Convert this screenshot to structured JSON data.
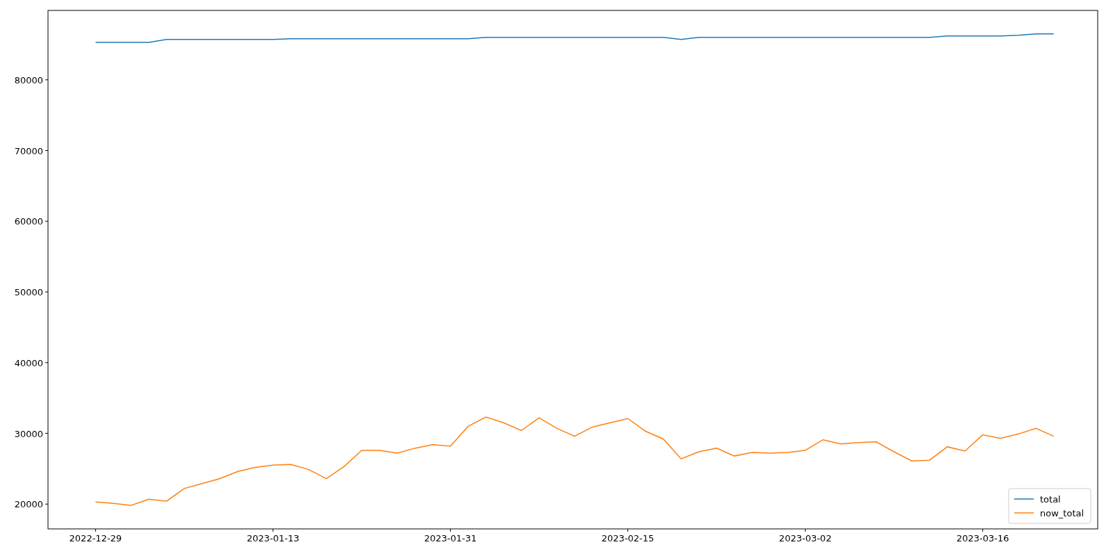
{
  "figure": {
    "chart_data": {
      "type": "line",
      "categories": [
        "2022-12-29",
        null,
        null,
        null,
        null,
        null,
        null,
        null,
        null,
        null,
        "2023-01-13",
        null,
        null,
        null,
        null,
        null,
        null,
        null,
        null,
        null,
        "2023-01-31",
        null,
        null,
        null,
        null,
        null,
        null,
        null,
        null,
        null,
        "2023-02-15",
        null,
        null,
        null,
        null,
        null,
        null,
        null,
        null,
        null,
        "2023-03-02",
        null,
        null,
        null,
        null,
        null,
        null,
        null,
        null,
        null,
        "2023-03-16",
        null,
        null,
        null,
        null
      ],
      "ylim": [
        16490,
        89810
      ],
      "legend": "lower right",
      "yticks": [
        20000,
        30000,
        40000,
        50000,
        60000,
        70000,
        80000
      ],
      "series": [
        {
          "name": "total",
          "color": "#1f77b4",
          "values": [
            85300,
            85300,
            85300,
            85300,
            85700,
            85700,
            85700,
            85700,
            85700,
            85700,
            85700,
            85800,
            85800,
            85800,
            85800,
            85800,
            85800,
            85800,
            85800,
            85800,
            85800,
            85800,
            86000,
            86000,
            86000,
            86000,
            86000,
            86000,
            86000,
            86000,
            86000,
            86000,
            86000,
            85700,
            86000,
            86000,
            86000,
            86000,
            86000,
            86000,
            86000,
            86000,
            86000,
            86000,
            86000,
            86000,
            86000,
            86000,
            86200,
            86200,
            86200,
            86200,
            86300,
            86500,
            86500
          ]
        },
        {
          "name": "now_total",
          "color": "#ff7f0e",
          "values": [
            20300,
            20100,
            19800,
            20700,
            20400,
            22200,
            22900,
            23600,
            24600,
            25200,
            25500,
            25600,
            24900,
            23600,
            25300,
            27600,
            27600,
            27200,
            27900,
            28400,
            28200,
            31000,
            32300,
            31500,
            30400,
            32200,
            30700,
            29600,
            30900,
            31500,
            32100,
            30300,
            29200,
            26400,
            27400,
            27900,
            26800,
            27300,
            27200,
            27300,
            27600,
            29100,
            28500,
            28700,
            28800,
            27400,
            26100,
            26200,
            28100,
            27500,
            29800,
            29300,
            29900,
            30700,
            29600
          ]
        }
      ]
    }
  }
}
